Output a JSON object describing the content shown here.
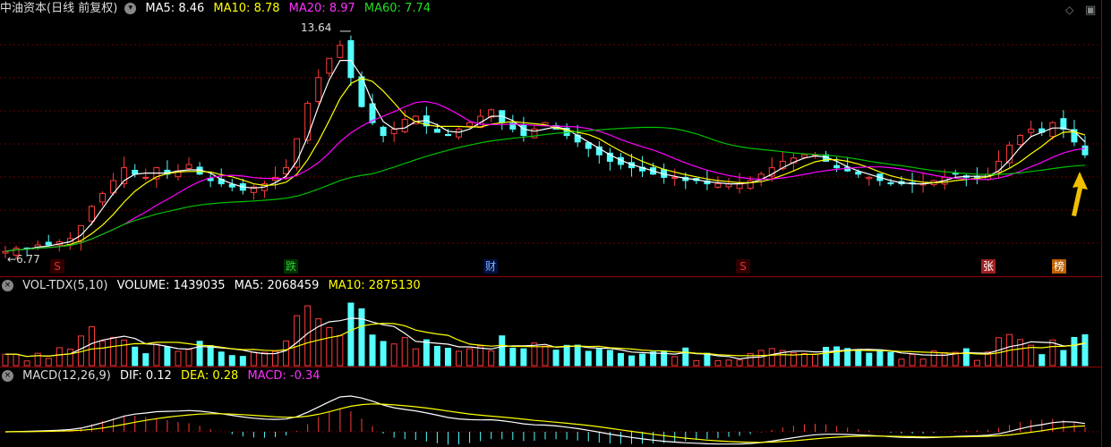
{
  "main": {
    "title": "中油资本(日线 前复权)",
    "ma5_label": "MA5: 8.46",
    "ma10_label": "MA10: 8.78",
    "ma20_label": "MA20: 8.97",
    "ma60_label": "MA60: 7.74",
    "high_label": "13.64",
    "low_label": "6.77",
    "event_markers": [
      {
        "text": "S",
        "color": "#e03030",
        "bg": "#300000"
      },
      {
        "text": "跌",
        "color": "#30d030",
        "bg": "#003000"
      },
      {
        "text": "财",
        "color": "#80b0ff",
        "bg": "#001040"
      },
      {
        "text": "S",
        "color": "#e03030",
        "bg": "#300000"
      },
      {
        "text": "张",
        "color": "#ffffff",
        "bg": "#a02020"
      },
      {
        "text": "榜",
        "color": "#ffffff",
        "bg": "#c06000"
      }
    ],
    "colors": {
      "up": "#ff3b3b",
      "down": "#54ffff",
      "ma5": "#ffffff",
      "ma10": "#ffff00",
      "ma20": "#ff00ff",
      "ma60": "#00c000",
      "arrow": "#f0c000"
    }
  },
  "volume": {
    "title": "VOL-TDX(5,10)",
    "volume_label": "VOLUME: 1439035",
    "ma5_label": "MA5: 2068459",
    "ma10_label": "MA10: 2875130"
  },
  "macd": {
    "title": "MACD(12,26,9)",
    "dif_label": "DIF: 0.12",
    "dea_label": "DEA: 0.28",
    "macd_label": "MACD: -0.34"
  },
  "icons": {
    "settings": "◇",
    "menu": "▣",
    "volume_close": "×"
  },
  "chart_data": {
    "type": "candlestick",
    "ylim": [
      6.5,
      14.0
    ],
    "series": [
      {
        "name": "MA5",
        "values": [
          8.46
        ]
      },
      {
        "name": "MA10",
        "values": [
          8.78
        ]
      },
      {
        "name": "MA20",
        "values": [
          8.97
        ]
      },
      {
        "name": "MA60",
        "values": [
          7.74
        ]
      }
    ],
    "annotations": [
      {
        "text": "13.64",
        "value": 13.64
      },
      {
        "text": "6.77",
        "value": 6.77
      }
    ],
    "closes_approx": [
      6.8,
      6.9,
      6.9,
      7.0,
      7.0,
      7.1,
      7.2,
      7.6,
      8.2,
      8.6,
      9.0,
      9.4,
      9.2,
      9.1,
      9.4,
      9.2,
      9.3,
      9.5,
      9.2,
      9.0,
      8.9,
      8.8,
      8.7,
      8.8,
      8.9,
      9.1,
      9.4,
      10.3,
      11.4,
      12.2,
      12.8,
      13.2,
      12.2,
      11.3,
      10.8,
      10.4,
      10.6,
      10.9,
      11.0,
      10.7,
      10.5,
      10.4,
      10.6,
      10.8,
      11.0,
      11.2,
      10.8,
      10.6,
      10.4,
      10.6,
      10.8,
      10.6,
      10.4,
      10.2,
      10.0,
      9.8,
      9.6,
      9.5,
      9.4,
      9.3,
      9.2,
      9.1,
      9.1,
      9.0,
      9.0,
      8.9,
      8.9,
      8.9,
      8.9,
      9.0,
      9.2,
      9.4,
      9.6,
      9.7,
      9.8,
      9.8,
      9.6,
      9.4,
      9.3,
      9.2,
      9.1,
      9.0,
      8.9,
      8.9,
      8.9,
      8.9,
      9.0,
      9.1,
      9.2,
      9.1,
      9.1,
      9.2,
      9.6,
      10.1,
      10.4,
      10.6,
      10.5,
      10.8,
      10.6,
      10.2,
      9.8
    ],
    "volume_unit": "shares",
    "macd": {
      "dif": 0.12,
      "dea": 0.28,
      "macd": -0.34
    }
  }
}
